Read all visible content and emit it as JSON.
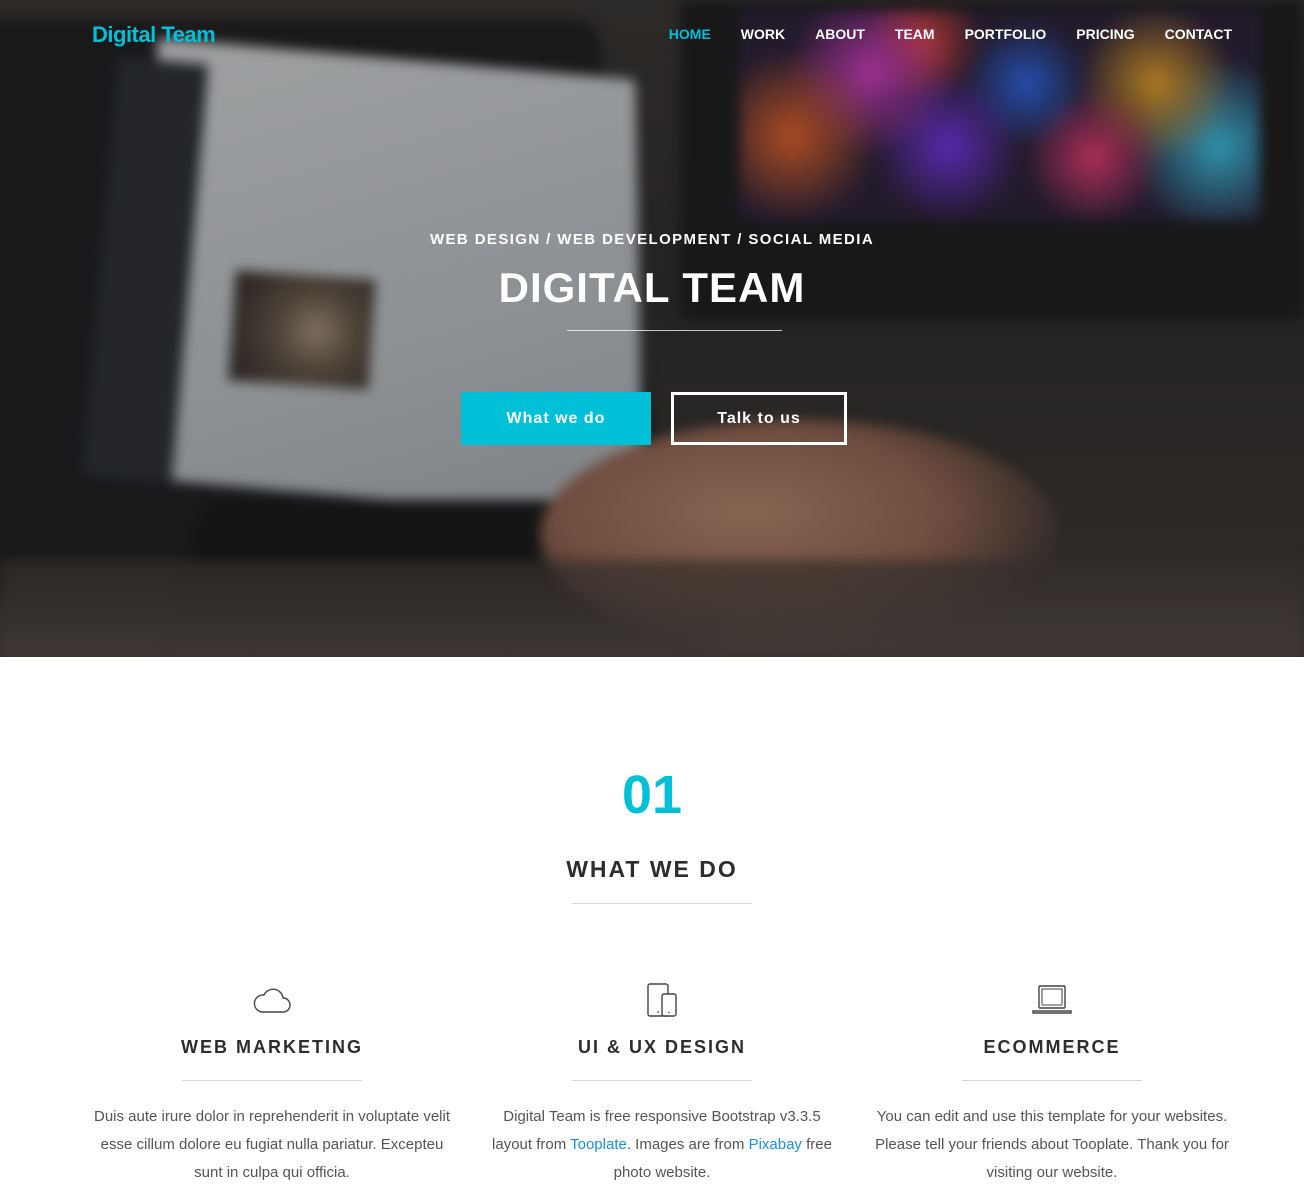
{
  "brand": "Digital Team",
  "nav": {
    "items": [
      "HOME",
      "WORK",
      "ABOUT",
      "TEAM",
      "PORTFOLIO",
      "PRICING",
      "CONTACT"
    ],
    "active": "HOME"
  },
  "hero": {
    "subtitle": "WEB DESIGN / WEB DEVELOPMENT / SOCIAL MEDIA",
    "title": "DIGITAL TEAM",
    "primary_button": "What we do",
    "secondary_button": "Talk to us"
  },
  "section": {
    "number": "01",
    "title": "WHAT WE DO"
  },
  "services": [
    {
      "icon": "cloud-icon",
      "title": "WEB MARKETING",
      "text": "Duis aute irure dolor in reprehenderit in voluptate velit esse cillum dolore eu fugiat nulla pariatur. Excepteu sunt in culpa qui officia."
    },
    {
      "icon": "devices-icon",
      "title": "UI & UX DESIGN",
      "text_before": "Digital Team is free responsive Bootstrap v3.3.5 layout from ",
      "link1": "Tooplate",
      "text_middle": ". Images are from ",
      "link2": "Pixabay",
      "text_after": " free photo website."
    },
    {
      "icon": "laptop-icon",
      "title": "ECOMMERCE",
      "text": "You can edit and use this template for your websites. Please tell your friends about Tooplate. Thank you for visiting our website."
    }
  ],
  "colors": {
    "accent": "#00c0d8",
    "link": "#1f8fd6",
    "heading": "#2d2d2d"
  }
}
